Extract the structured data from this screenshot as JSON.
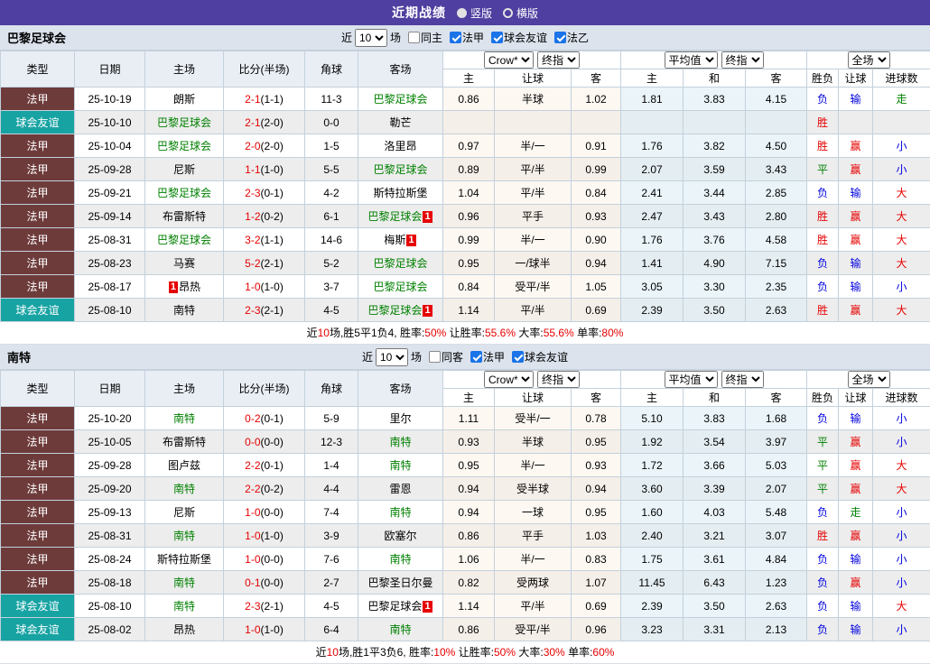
{
  "topbar": {
    "title": "近期战绩",
    "radios": [
      {
        "label": "竖版",
        "selected": true
      },
      {
        "label": "横版",
        "selected": false
      }
    ]
  },
  "columns": {
    "type": "类型",
    "date": "日期",
    "home": "主场",
    "score": "比分(半场)",
    "corner": "角球",
    "away": "客场",
    "crow_home": "主",
    "crow_handicap": "让球",
    "crow_away": "客",
    "avg_home": "主",
    "avg_draw": "和",
    "avg_away": "客",
    "result": "胜负",
    "handicap_result": "让球",
    "goals": "进球数"
  },
  "selects": {
    "crow": "Crow*",
    "final1": "终指",
    "average": "平均值",
    "final2": "终指",
    "fullmatch": "全场"
  },
  "colors": {
    "header_purple": "#4e3fa0",
    "filter_bg": "#dce3ed",
    "ligue1_cell": "#6e3b3b",
    "friendly_cell": "#18a3a3",
    "win_red": "#e60000",
    "lose_blue": "#0000e0",
    "draw_green": "#008000"
  },
  "tables": [
    {
      "team": "巴黎足球会",
      "filter": {
        "prefix": "近",
        "count": "10",
        "suffix": "场",
        "checkboxes": [
          {
            "label": "同主",
            "checked": false
          },
          {
            "label": "法甲",
            "checked": true
          },
          {
            "label": "球会友谊",
            "checked": true
          },
          {
            "label": "法乙",
            "checked": true
          }
        ]
      },
      "rows": [
        {
          "type": "法甲",
          "date": "25-10-19",
          "home": {
            "n": "朗斯"
          },
          "score": "2-1",
          "half": "(1-1)",
          "corner": "11-3",
          "away": {
            "n": "巴黎足球会",
            "g": true
          },
          "odds": [
            "0.86",
            "半球",
            "1.02",
            "1.81",
            "3.83",
            "4.15"
          ],
          "res": [
            "负",
            "输",
            "走"
          ]
        },
        {
          "type": "球会友谊",
          "date": "25-10-10",
          "home": {
            "n": "巴黎足球会",
            "g": true
          },
          "score": "2-1",
          "half": "(2-0)",
          "corner": "0-0",
          "away": {
            "n": "勒芒"
          },
          "odds": [
            "",
            "",
            "",
            "",
            "",
            ""
          ],
          "res": [
            "胜",
            "",
            ""
          ]
        },
        {
          "type": "法甲",
          "date": "25-10-04",
          "home": {
            "n": "巴黎足球会",
            "g": true
          },
          "score": "2-0",
          "half": "(2-0)",
          "corner": "1-5",
          "away": {
            "n": "洛里昂"
          },
          "odds": [
            "0.97",
            "半/一",
            "0.91",
            "1.76",
            "3.82",
            "4.50"
          ],
          "res": [
            "胜",
            "赢",
            "小"
          ]
        },
        {
          "type": "法甲",
          "date": "25-09-28",
          "home": {
            "n": "尼斯"
          },
          "score": "1-1",
          "half": "(1-0)",
          "corner": "5-5",
          "away": {
            "n": "巴黎足球会",
            "g": true
          },
          "odds": [
            "0.89",
            "平/半",
            "0.99",
            "2.07",
            "3.59",
            "3.43"
          ],
          "res": [
            "平",
            "赢",
            "小"
          ]
        },
        {
          "type": "法甲",
          "date": "25-09-21",
          "home": {
            "n": "巴黎足球会",
            "g": true
          },
          "score": "2-3",
          "half": "(0-1)",
          "corner": "4-2",
          "away": {
            "n": "斯特拉斯堡"
          },
          "odds": [
            "1.04",
            "平/半",
            "0.84",
            "2.41",
            "3.44",
            "2.85"
          ],
          "res": [
            "负",
            "输",
            "大"
          ]
        },
        {
          "type": "法甲",
          "date": "25-09-14",
          "home": {
            "n": "布雷斯特"
          },
          "score": "1-2",
          "half": "(0-2)",
          "corner": "6-1",
          "away": {
            "n": "巴黎足球会",
            "g": true,
            "post": "1"
          },
          "odds": [
            "0.96",
            "平手",
            "0.93",
            "2.47",
            "3.43",
            "2.80"
          ],
          "res": [
            "胜",
            "赢",
            "大"
          ]
        },
        {
          "type": "法甲",
          "date": "25-08-31",
          "home": {
            "n": "巴黎足球会",
            "g": true
          },
          "score": "3-2",
          "half": "(1-1)",
          "corner": "14-6",
          "away": {
            "n": "梅斯",
            "post": "1"
          },
          "odds": [
            "0.99",
            "半/一",
            "0.90",
            "1.76",
            "3.76",
            "4.58"
          ],
          "res": [
            "胜",
            "赢",
            "大"
          ]
        },
        {
          "type": "法甲",
          "date": "25-08-23",
          "home": {
            "n": "马赛"
          },
          "score": "5-2",
          "half": "(2-1)",
          "corner": "5-2",
          "away": {
            "n": "巴黎足球会",
            "g": true
          },
          "odds": [
            "0.95",
            "一/球半",
            "0.94",
            "1.41",
            "4.90",
            "7.15"
          ],
          "res": [
            "负",
            "输",
            "大"
          ]
        },
        {
          "type": "法甲",
          "date": "25-08-17",
          "home": {
            "n": "昂热",
            "pre": "1"
          },
          "score": "1-0",
          "half": "(1-0)",
          "corner": "3-7",
          "away": {
            "n": "巴黎足球会",
            "g": true
          },
          "odds": [
            "0.84",
            "受平/半",
            "1.05",
            "3.05",
            "3.30",
            "2.35"
          ],
          "res": [
            "负",
            "输",
            "小"
          ]
        },
        {
          "type": "球会友谊",
          "date": "25-08-10",
          "home": {
            "n": "南特"
          },
          "score": "2-3",
          "half": "(2-1)",
          "corner": "4-5",
          "away": {
            "n": "巴黎足球会",
            "g": true,
            "post": "1"
          },
          "odds": [
            "1.14",
            "平/半",
            "0.69",
            "2.39",
            "3.50",
            "2.63"
          ],
          "res": [
            "胜",
            "赢",
            "大"
          ]
        }
      ],
      "summary": [
        [
          "近",
          0
        ],
        [
          "10",
          1
        ],
        [
          "场,胜5平1负4, 胜率:",
          0
        ],
        [
          "50%",
          1
        ],
        [
          " 让胜率:",
          0
        ],
        [
          "55.6%",
          1
        ],
        [
          " 大率:",
          0
        ],
        [
          "55.6%",
          1
        ],
        [
          " 单率:",
          0
        ],
        [
          "80%",
          1
        ]
      ]
    },
    {
      "team": "南特",
      "filter": {
        "prefix": "近",
        "count": "10",
        "suffix": "场",
        "checkboxes": [
          {
            "label": "同客",
            "checked": false
          },
          {
            "label": "法甲",
            "checked": true
          },
          {
            "label": "球会友谊",
            "checked": true
          }
        ]
      },
      "rows": [
        {
          "type": "法甲",
          "date": "25-10-20",
          "home": {
            "n": "南特",
            "g": true
          },
          "score": "0-2",
          "half": "(0-1)",
          "corner": "5-9",
          "away": {
            "n": "里尔"
          },
          "odds": [
            "1.11",
            "受半/一",
            "0.78",
            "5.10",
            "3.83",
            "1.68"
          ],
          "res": [
            "负",
            "输",
            "小"
          ]
        },
        {
          "type": "法甲",
          "date": "25-10-05",
          "home": {
            "n": "布雷斯特"
          },
          "score": "0-0",
          "half": "(0-0)",
          "corner": "12-3",
          "away": {
            "n": "南特",
            "g": true
          },
          "odds": [
            "0.93",
            "半球",
            "0.95",
            "1.92",
            "3.54",
            "3.97"
          ],
          "res": [
            "平",
            "赢",
            "小"
          ]
        },
        {
          "type": "法甲",
          "date": "25-09-28",
          "home": {
            "n": "图卢兹"
          },
          "score": "2-2",
          "half": "(0-1)",
          "corner": "1-4",
          "away": {
            "n": "南特",
            "g": true
          },
          "odds": [
            "0.95",
            "半/一",
            "0.93",
            "1.72",
            "3.66",
            "5.03"
          ],
          "res": [
            "平",
            "赢",
            "大"
          ]
        },
        {
          "type": "法甲",
          "date": "25-09-20",
          "home": {
            "n": "南特",
            "g": true
          },
          "score": "2-2",
          "half": "(0-2)",
          "corner": "4-4",
          "away": {
            "n": "雷恩"
          },
          "odds": [
            "0.94",
            "受半球",
            "0.94",
            "3.60",
            "3.39",
            "2.07"
          ],
          "res": [
            "平",
            "赢",
            "大"
          ]
        },
        {
          "type": "法甲",
          "date": "25-09-13",
          "home": {
            "n": "尼斯"
          },
          "score": "1-0",
          "half": "(0-0)",
          "corner": "7-4",
          "away": {
            "n": "南特",
            "g": true
          },
          "odds": [
            "0.94",
            "一球",
            "0.95",
            "1.60",
            "4.03",
            "5.48"
          ],
          "res": [
            "负",
            "走",
            "小"
          ]
        },
        {
          "type": "法甲",
          "date": "25-08-31",
          "home": {
            "n": "南特",
            "g": true
          },
          "score": "1-0",
          "half": "(1-0)",
          "corner": "3-9",
          "away": {
            "n": "欧塞尔"
          },
          "odds": [
            "0.86",
            "平手",
            "1.03",
            "2.40",
            "3.21",
            "3.07"
          ],
          "res": [
            "胜",
            "赢",
            "小"
          ]
        },
        {
          "type": "法甲",
          "date": "25-08-24",
          "home": {
            "n": "斯特拉斯堡"
          },
          "score": "1-0",
          "half": "(0-0)",
          "corner": "7-6",
          "away": {
            "n": "南特",
            "g": true
          },
          "odds": [
            "1.06",
            "半/一",
            "0.83",
            "1.75",
            "3.61",
            "4.84"
          ],
          "res": [
            "负",
            "输",
            "小"
          ]
        },
        {
          "type": "法甲",
          "date": "25-08-18",
          "home": {
            "n": "南特",
            "g": true
          },
          "score": "0-1",
          "half": "(0-0)",
          "corner": "2-7",
          "away": {
            "n": "巴黎圣日尔曼"
          },
          "odds": [
            "0.82",
            "受两球",
            "1.07",
            "11.45",
            "6.43",
            "1.23"
          ],
          "res": [
            "负",
            "赢",
            "小"
          ]
        },
        {
          "type": "球会友谊",
          "date": "25-08-10",
          "home": {
            "n": "南特",
            "g": true
          },
          "score": "2-3",
          "half": "(2-1)",
          "corner": "4-5",
          "away": {
            "n": "巴黎足球会",
            "post": "1"
          },
          "odds": [
            "1.14",
            "平/半",
            "0.69",
            "2.39",
            "3.50",
            "2.63"
          ],
          "res": [
            "负",
            "输",
            "大"
          ]
        },
        {
          "type": "球会友谊",
          "date": "25-08-02",
          "home": {
            "n": "昂热"
          },
          "score": "1-0",
          "half": "(1-0)",
          "corner": "6-4",
          "away": {
            "n": "南特",
            "g": true
          },
          "odds": [
            "0.86",
            "受平/半",
            "0.96",
            "3.23",
            "3.31",
            "2.13"
          ],
          "res": [
            "负",
            "输",
            "小"
          ]
        }
      ],
      "summary": [
        [
          "近",
          0
        ],
        [
          "10",
          1
        ],
        [
          "场,胜1平3负6, 胜率:",
          0
        ],
        [
          "10%",
          1
        ],
        [
          " 让胜率:",
          0
        ],
        [
          "50%",
          1
        ],
        [
          " 大率:",
          0
        ],
        [
          "30%",
          1
        ],
        [
          " 单率:",
          0
        ],
        [
          "60%",
          1
        ]
      ]
    }
  ]
}
